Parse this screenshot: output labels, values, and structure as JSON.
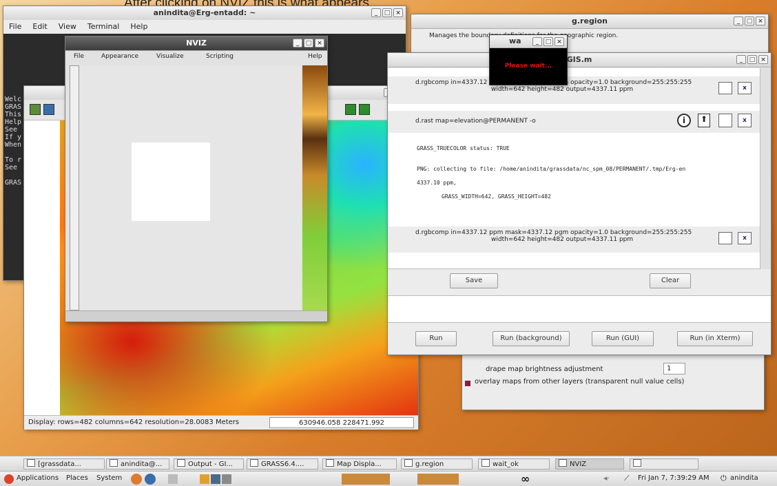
{
  "caption": "After clicking on NVIZ this is what appears.",
  "terminal": {
    "title": "anindita@Erg-entadd: ~",
    "menu": [
      "File",
      "Edit",
      "View",
      "Terminal",
      "Help"
    ],
    "lines": [
      "Welc",
      "GRAS",
      "This",
      "Help",
      "See",
      "If y",
      "When",
      "",
      "To r",
      "See",
      "",
      "GRAS"
    ]
  },
  "mapdisplay": {
    "status_left": "Display: rows=482  columns=642  resolution=28.0083 Meters",
    "status_right": "630946.058   228471.992"
  },
  "nviz": {
    "title": "NVIZ",
    "menu": [
      "File",
      "Appearance",
      "Visualize",
      "Scripting",
      "Help"
    ]
  },
  "gregion": {
    "title": "g.region",
    "subtitle": "Manages the boundary definitions for the geographic region."
  },
  "wait": {
    "title": "wa",
    "message": "Please wait..."
  },
  "gisoutput": {
    "title": "GIS.m",
    "cmd1": "d.rgbcomp in=4337.12 ppm mask=4337.12 pgm opacity=1.0 background=255:255:255",
    "cmd1b": "width=642 height=482 output=4337.11 ppm",
    "cmd2": "d.rast map=elevation@PERMANENT -o",
    "log1": "GRASS_TRUECOLOR status: TRUE",
    "log2": "PNG: collecting to file: /home/anindita/grassdata/nc_spm_08/PERMANENT/.tmp/Erg-en",
    "log3": "4337.10 ppm,",
    "log4": "GRASS_WIDTH=642, GRASS_HEIGHT=482",
    "cmd3": "d.rgbcomp in=4337.12 ppm mask=4337.12 pgm opacity=1.0 background=255:255:255",
    "cmd3b": "width=642 height=482 output=4337.11 ppm",
    "save": "Save",
    "clear": "Clear",
    "run": "Run",
    "run_bg": "Run (background)",
    "run_gui": "Run (GUI)",
    "run_xterm": "Run (in Xterm)"
  },
  "layeropts": {
    "drape_label": "drape map brightness adjustment",
    "drape_value": "1",
    "overlay_label": "overlay maps from other layers (transparent null value cells)"
  },
  "taskbar_windows": [
    "[grassdata...",
    "anindita@...",
    "Output - GI...",
    "GRASS6.4....",
    "Map Displa...",
    "g.region",
    "wait_ok",
    "NVIZ"
  ],
  "panel": {
    "applications": "Applications",
    "places": "Places",
    "system": "System",
    "clock": "Fri Jan 7, 7:39:29 AM",
    "user": "anindita"
  }
}
